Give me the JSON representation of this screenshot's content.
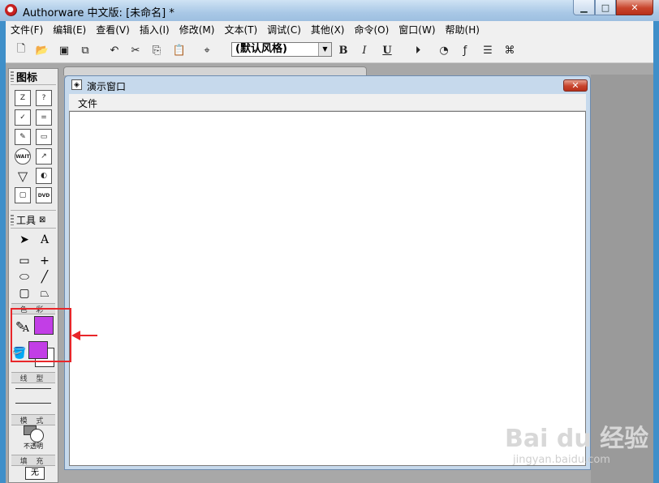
{
  "window": {
    "title": "Authorware 中文版: [未命名] *"
  },
  "menu": [
    "文件(F)",
    "编辑(E)",
    "查看(V)",
    "插入(I)",
    "修改(M)",
    "文本(T)",
    "调试(C)",
    "其他(X)",
    "命令(O)",
    "窗口(W)",
    "帮助(H)"
  ],
  "toolbar": {
    "style_value": "(默认风格)",
    "bold": "B",
    "italic": "I",
    "underline": "U"
  },
  "icon_palette": {
    "title": "图标",
    "icons": [
      "Z",
      "?",
      "✓",
      "=",
      "✎",
      "▭",
      "WAIT",
      "↗",
      "▽",
      "◐",
      "▢",
      "DVD"
    ]
  },
  "tools": {
    "title": "工具",
    "color_label": "色 彩",
    "line_label": "线 型",
    "mode_label": "模 式",
    "mode_value": "不透明",
    "fill_label": "填 充",
    "fill_value": "无",
    "text_tool": "A",
    "swatch_color": "#c23ee6"
  },
  "presentation": {
    "title": "演示窗口",
    "menu_file": "文件"
  },
  "watermark": {
    "brand": "Bai du 经验",
    "url": "jingyan.baidu.com"
  }
}
